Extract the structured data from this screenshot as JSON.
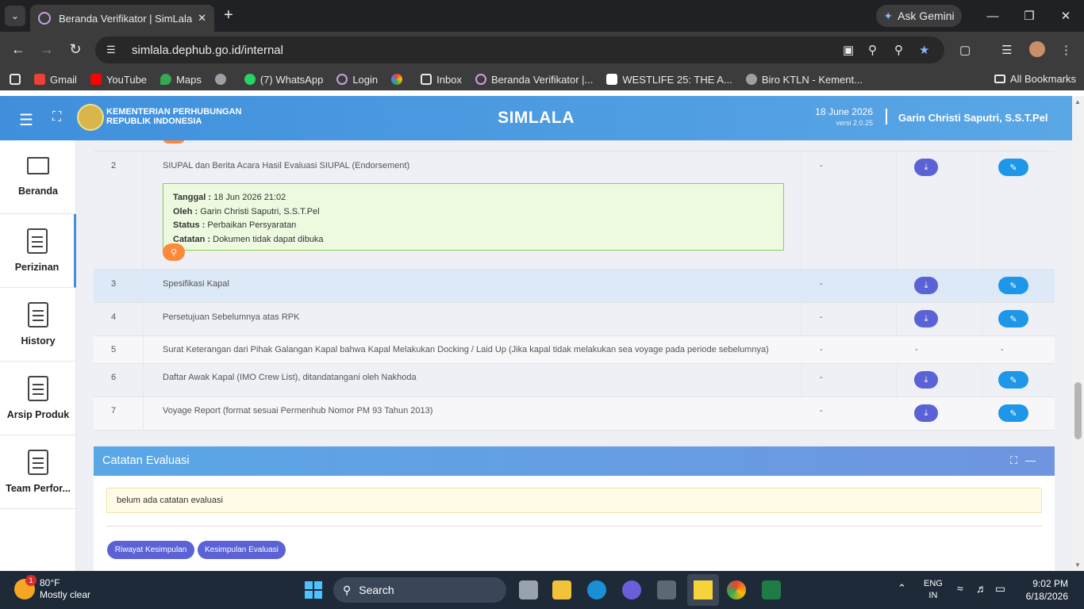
{
  "browser": {
    "tab_title": "Beranda Verifikator | SimLala",
    "ask_gemini": "Ask Gemini",
    "url": "simlala.dephub.go.id/internal",
    "bookmarks": [
      "Gmail",
      "YouTube",
      "Maps",
      "",
      "(7) WhatsApp",
      "Login",
      "",
      "Inbox",
      "Beranda Verifikator |...",
      "WESTLIFE 25: THE A...",
      "Biro KTLN - Kement..."
    ],
    "all_bookmarks": "All Bookmarks"
  },
  "header": {
    "ministry_line1": "KEMENTERIAN PERHUBUNGAN",
    "ministry_line2": "REPUBLIK INDONESIA",
    "app_name": "SIMLALA",
    "date": "18 June 2026",
    "version": "versi 2.0.25",
    "user": "Garin Christi Saputri, S.S.T.Pel"
  },
  "sidebar": {
    "items": [
      {
        "label": "Beranda"
      },
      {
        "label": "Perizinan"
      },
      {
        "label": "History"
      },
      {
        "label": "Arsip Produk"
      },
      {
        "label": "Team Perfor..."
      }
    ]
  },
  "documents": {
    "rows": [
      {
        "no": "2",
        "name": "SIUPAL dan Berita Acara Hasil Evaluasi SIUPAL (Endorsement)",
        "col3": "-"
      },
      {
        "no": "3",
        "name": "Spesifikasi Kapal",
        "col3": "-"
      },
      {
        "no": "4",
        "name": "Persetujuan Sebelumnya atas RPK",
        "col3": "-"
      },
      {
        "no": "5",
        "name": "Surat Keterangan dari Pihak Galangan Kapal bahwa Kapal Melakukan Docking / Laid Up (Jika kapal tidak melakukan sea voyage pada periode sebelumnya)",
        "col3": "-",
        "col4": "-",
        "col5": "-"
      },
      {
        "no": "6",
        "name": "Daftar Awak Kapal (IMO Crew List), ditandatangani oleh Nakhoda",
        "col3": "-"
      },
      {
        "no": "7",
        "name": "Voyage Report (format sesuai Permenhub Nomor PM 93 Tahun 2013)",
        "col3": "-"
      }
    ],
    "note": {
      "tanggal_label": "Tanggal :",
      "tanggal": "18 Jun 2026 21:02",
      "oleh_label": "Oleh :",
      "oleh": "Garin Christi Saputri, S.S.T.Pel",
      "status_label": "Status :",
      "status": "Perbaikan Persyaratan",
      "catatan_label": "Catatan :",
      "catatan": "Dokumen tidak dapat dibuka"
    }
  },
  "evaluasi": {
    "title": "Catatan Evaluasi",
    "empty_note": "belum ada catatan evaluasi",
    "btn_riwayat": "Riwayat Kesimpulan",
    "btn_kesimpulan": "Kesimpulan Evaluasi"
  },
  "taskbar": {
    "badge": "1",
    "temp": "80°F",
    "weather": "Mostly clear",
    "search": "Search",
    "lang1": "ENG",
    "lang2": "IN",
    "time": "9:02 PM",
    "date": "6/18/2026"
  }
}
